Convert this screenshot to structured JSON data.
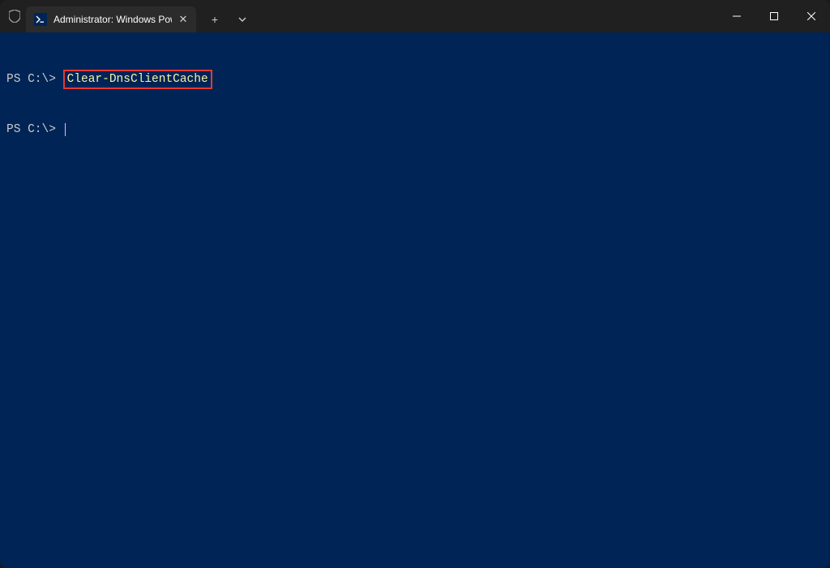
{
  "titlebar": {
    "tab_title": "Administrator: Windows Powe",
    "new_tab_label": "+",
    "dropdown_label": "⌄"
  },
  "window_controls": {
    "minimize": "—",
    "maximize": "□",
    "close": "✕"
  },
  "terminal": {
    "lines": [
      {
        "prompt": "PS C:\\> ",
        "command": "Clear-DnsClientCache"
      },
      {
        "prompt": "PS C:\\> ",
        "command": ""
      }
    ]
  },
  "icons": {
    "shield": "shield-icon",
    "powershell": "powershell-icon",
    "close_tab": "✕"
  }
}
